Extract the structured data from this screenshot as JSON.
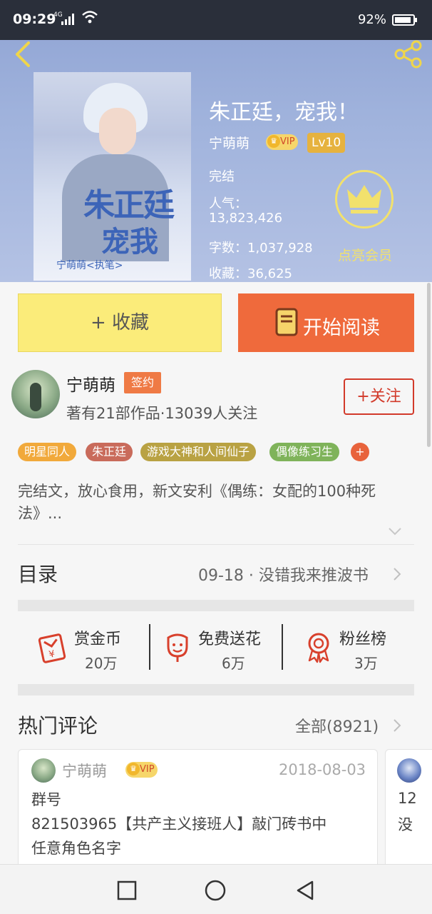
{
  "status_bar": {
    "time": "09:29",
    "network": "4G",
    "battery": "92%"
  },
  "book": {
    "title": "朱正廷，宠我！",
    "author": "宁萌萌",
    "vip_label": "VIP",
    "level": "Lv10",
    "status": "完结",
    "popularity_label": "人气：",
    "popularity_value": "13,823,426",
    "word_count": "字数：1,037,928",
    "favorites": "收藏：36,625",
    "member_label": "点亮会员"
  },
  "cover": {
    "title_line1": "朱正廷",
    "title_line2": "宠我",
    "byline": "宁萌萌<执笔>"
  },
  "actions": {
    "favorite": "+ 收藏",
    "read": "开始阅读"
  },
  "author_card": {
    "name": "宁萌萌",
    "badge": "签约",
    "summary": "著有21部作品·13039人关注",
    "follow": "+关注"
  },
  "tags": [
    {
      "label": "明星同人",
      "color": "#f1a93b"
    },
    {
      "label": "朱正廷",
      "color": "#c96b5b"
    },
    {
      "label": "游戏大神和人间仙子",
      "color": "#b9a243"
    },
    {
      "label": "偶像练习生",
      "color": "#7fb35a"
    }
  ],
  "tag_more": "+",
  "description": "完结文，放心食用，新文安利《偶练：女配的100种死法》...",
  "toc": {
    "label": "目录",
    "latest": "09-18 · 没错我来推波书"
  },
  "stats": [
    {
      "name": "赏金币",
      "value": "20万"
    },
    {
      "name": "免费送花",
      "value": "6万"
    },
    {
      "name": "粉丝榜",
      "value": "3万"
    }
  ],
  "comments": {
    "label": "热门评论",
    "all": "全部(8921)",
    "items": [
      {
        "user": "宁萌萌",
        "vip": "VIP",
        "date": "2018-08-03",
        "line1": "群号",
        "line2": "821503965【共产主义接班人】敲门砖书中",
        "line3": "任意角色名字"
      }
    ],
    "peek": {
      "line1": "12",
      "line2": "没"
    }
  },
  "colors": {
    "accent": "#ef6a3c",
    "favorite_bg": "#fbec7a",
    "follow": "#d23a2a",
    "crown": "#f2e16c"
  },
  "icons": [
    "back-icon",
    "share-icon",
    "crown-icon",
    "book-icon",
    "red-envelope-icon",
    "flower-icon",
    "medal-icon",
    "chevron-right-icon",
    "chevron-down-icon"
  ]
}
